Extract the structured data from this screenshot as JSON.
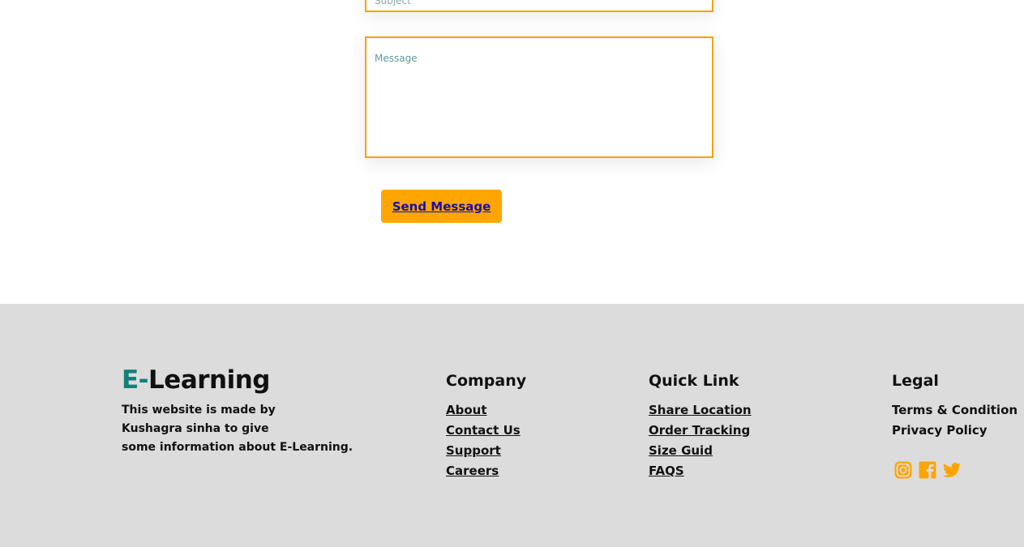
{
  "form": {
    "subject_placeholder": "Subject",
    "message_placeholder": "Message",
    "send_label": "Send Message"
  },
  "footer": {
    "brand": {
      "prefix": "E-",
      "name": "Learning",
      "accent_color": "#12807a"
    },
    "about_lines": [
      "This website is made by",
      "Kushagra sinha to give",
      "some information about E-Learning."
    ],
    "company": {
      "title": "Company",
      "links": [
        "About",
        "Contact Us",
        "Support",
        "Careers"
      ]
    },
    "quick_link": {
      "title": "Quick Link",
      "links": [
        "Share Location",
        "Order Tracking",
        "Size Guid",
        "FAQS"
      ]
    },
    "legal": {
      "title": "Legal",
      "links": [
        "Terms & Condition",
        "Privacy Policy"
      ]
    },
    "socials": [
      "instagram-icon",
      "facebook-icon",
      "twitter-icon"
    ],
    "social_color": "#ffa500",
    "background": "#dcdcdc"
  },
  "colors": {
    "input_border": "#f5a400",
    "button_bg": "#ffa500",
    "button_text": "#1a0dab"
  }
}
